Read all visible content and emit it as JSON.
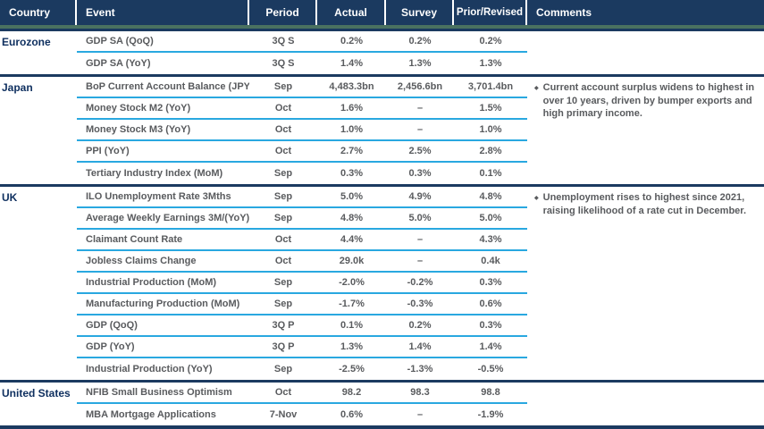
{
  "table": {
    "columns": [
      "Country",
      "Event",
      "Period",
      "Actual",
      "Survey",
      "Prior/Revised",
      "Comments"
    ],
    "bullet_icon": "◆",
    "colors": {
      "header_bg": "#1b3a60",
      "accent_blue": "#29a8e0",
      "accent_green": "#4a7160",
      "country_text": "#0e2f5f",
      "cell_text": "#595b5e"
    },
    "groups": [
      {
        "country": "Eurozone",
        "comment": "",
        "rows": [
          {
            "event": "GDP SA (QoQ)",
            "period": "3Q S",
            "actual": "0.2%",
            "survey": "0.2%",
            "prior": "0.2%"
          },
          {
            "event": "GDP SA (YoY)",
            "period": "3Q S",
            "actual": "1.4%",
            "survey": "1.3%",
            "prior": "1.3%"
          }
        ]
      },
      {
        "country": "Japan",
        "comment": "Current account surplus widens to highest in over 10 years, driven by bumper exports and high primary income.",
        "rows": [
          {
            "event": "BoP Current Account Balance (JPY)",
            "period": "Sep",
            "actual": "4,483.3bn",
            "survey": "2,456.6bn",
            "prior": "3,701.4bn"
          },
          {
            "event": "Money Stock M2 (YoY)",
            "period": "Oct",
            "actual": "1.6%",
            "survey": "–",
            "prior": "1.5%"
          },
          {
            "event": "Money Stock M3 (YoY)",
            "period": "Oct",
            "actual": "1.0%",
            "survey": "–",
            "prior": "1.0%"
          },
          {
            "event": "PPI (YoY)",
            "period": "Oct",
            "actual": "2.7%",
            "survey": "2.5%",
            "prior": "2.8%"
          },
          {
            "event": "Tertiary Industry Index (MoM)",
            "period": "Sep",
            "actual": "0.3%",
            "survey": "0.3%",
            "prior": "0.1%"
          }
        ]
      },
      {
        "country": "UK",
        "comment": "Unemployment rises to highest since 2021, raising likelihood of a rate cut in December.",
        "rows": [
          {
            "event": "ILO Unemployment Rate 3Mths",
            "period": "Sep",
            "actual": "5.0%",
            "survey": "4.9%",
            "prior": "4.8%"
          },
          {
            "event": "Average Weekly Earnings 3M/(YoY)",
            "period": "Sep",
            "actual": "4.8%",
            "survey": "5.0%",
            "prior": "5.0%"
          },
          {
            "event": "Claimant Count Rate",
            "period": "Oct",
            "actual": "4.4%",
            "survey": "–",
            "prior": "4.3%"
          },
          {
            "event": "Jobless Claims Change",
            "period": "Oct",
            "actual": "29.0k",
            "survey": "–",
            "prior": "0.4k"
          },
          {
            "event": "Industrial Production (MoM)",
            "period": "Sep",
            "actual": "-2.0%",
            "survey": "-0.2%",
            "prior": "0.3%"
          },
          {
            "event": "Manufacturing Production (MoM)",
            "period": "Sep",
            "actual": "-1.7%",
            "survey": "-0.3%",
            "prior": "0.6%"
          },
          {
            "event": "GDP (QoQ)",
            "period": "3Q P",
            "actual": "0.1%",
            "survey": "0.2%",
            "prior": "0.3%"
          },
          {
            "event": "GDP (YoY)",
            "period": "3Q P",
            "actual": "1.3%",
            "survey": "1.4%",
            "prior": "1.4%"
          },
          {
            "event": "Industrial Production (YoY)",
            "period": "Sep",
            "actual": "-2.5%",
            "survey": "-1.3%",
            "prior": "-0.5%"
          }
        ]
      },
      {
        "country": "United States",
        "comment": "",
        "rows": [
          {
            "event": "NFIB Small Business Optimism",
            "period": "Oct",
            "actual": "98.2",
            "survey": "98.3",
            "prior": "98.8"
          },
          {
            "event": "MBA Mortgage Applications",
            "period": "7-Nov",
            "actual": "0.6%",
            "survey": "–",
            "prior": "-1.9%"
          }
        ]
      }
    ]
  }
}
